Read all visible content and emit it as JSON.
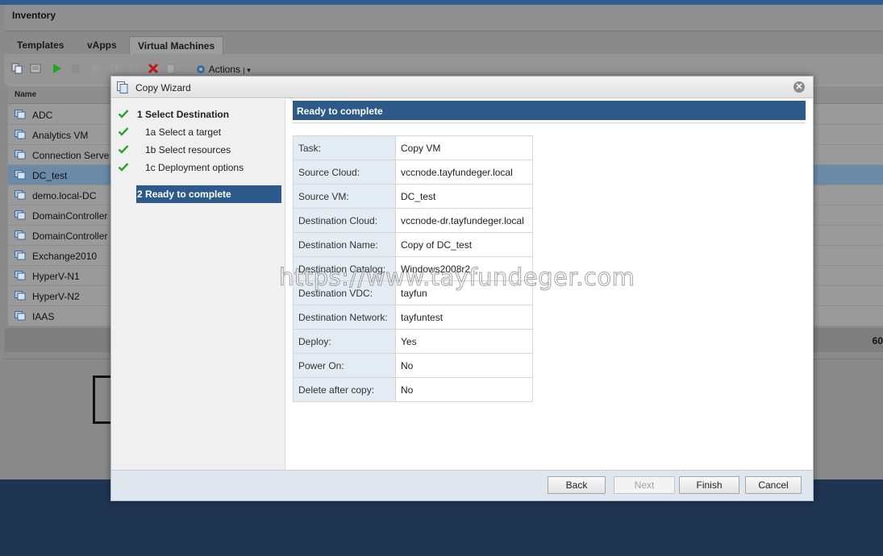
{
  "app": {
    "title": "Inventory",
    "tabs": [
      {
        "label": "Templates"
      },
      {
        "label": "vApps"
      },
      {
        "label": "Virtual Machines"
      }
    ],
    "toolbar": {
      "actions_label": "Actions"
    },
    "grid": {
      "name_header": "Name",
      "rows": [
        {
          "name": "ADC"
        },
        {
          "name": "Analytics VM"
        },
        {
          "name": "Connection Serve"
        },
        {
          "name": "DC_test"
        },
        {
          "name": "demo.local-DC"
        },
        {
          "name": "DomainController"
        },
        {
          "name": "DomainController"
        },
        {
          "name": "Exchange2010"
        },
        {
          "name": "HyperV-N1"
        },
        {
          "name": "HyperV-N2"
        },
        {
          "name": "IAAS"
        }
      ],
      "selected_row": "DC_test",
      "count_fragment": "60"
    }
  },
  "wizard": {
    "title": "Copy Wizard",
    "close_glyph": "✕",
    "steps": [
      {
        "number": "1",
        "label": "Select Destination",
        "done": true
      },
      {
        "number": "1a",
        "label": "Select a target",
        "done": true
      },
      {
        "number": "1b",
        "label": "Select resources",
        "done": true
      },
      {
        "number": "1c",
        "label": "Deployment options",
        "done": true
      },
      {
        "number": "2",
        "label": "Ready to complete",
        "current": true
      }
    ],
    "content_header": "Ready to complete",
    "summary": [
      {
        "key": "Task:",
        "value": "Copy VM"
      },
      {
        "key": "Source Cloud:",
        "value": "vccnode.tayfundeger.local"
      },
      {
        "key": "Source VM:",
        "value": "DC_test"
      },
      {
        "key": "Destination Cloud:",
        "value": "vccnode-dr.tayfundeger.local"
      },
      {
        "key": "Destination Name:",
        "value": "Copy of DC_test"
      },
      {
        "key": "Destination Catalog:",
        "value": "Windows2008r2"
      },
      {
        "key": "Destination VDC:",
        "value": "tayfun"
      },
      {
        "key": "Destination Network:",
        "value": "tayfuntest"
      },
      {
        "key": "Deploy:",
        "value": "Yes"
      },
      {
        "key": "Power On:",
        "value": "No"
      },
      {
        "key": "Delete after copy:",
        "value": "No"
      }
    ],
    "buttons": {
      "back": "Back",
      "next": "Next",
      "finish": "Finish",
      "cancel": "Cancel"
    }
  },
  "watermark": "https://www.tayfundeger.com",
  "colors": {
    "accent": "#2d5a8a",
    "check": "#2ea12e",
    "key_cell_bg": "#e3ecf3"
  }
}
